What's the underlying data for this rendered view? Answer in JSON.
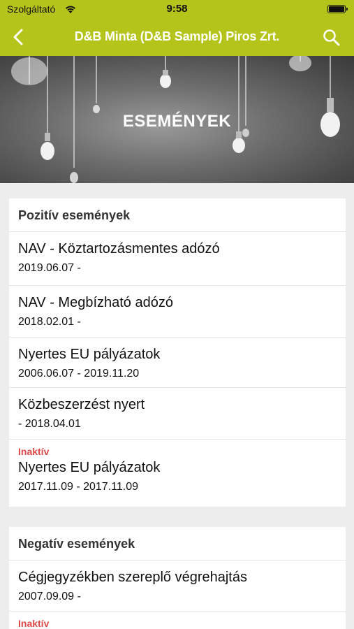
{
  "status_bar": {
    "carrier": "Szolgáltató",
    "time": "9:58"
  },
  "nav": {
    "title": "D&B Minta (D&B Sample) Piros Zrt.",
    "accent": "#b5c41a"
  },
  "hero": {
    "title": "ESEMÉNYEK"
  },
  "positive": {
    "header": "Pozitív események",
    "items": [
      {
        "name": "NAV - Köztartozásmentes adózó",
        "dates": "2019.06.07 -"
      },
      {
        "name": "NAV - Megbízható adózó",
        "dates": "2018.02.01 -"
      },
      {
        "name": "Nyertes EU pályázatok",
        "dates": "2006.06.07 - 2019.11.20"
      },
      {
        "name": "Közbeszerzést nyert",
        "dates": "- 2018.04.01"
      },
      {
        "tag": "Inaktív",
        "name": "Nyertes EU pályázatok",
        "dates": "2017.11.09 - 2017.11.09"
      }
    ]
  },
  "negative": {
    "header": "Negatív események",
    "items": [
      {
        "name": "Cégjegyzékben szereplő végrehajtás",
        "dates": "2007.09.09 -"
      },
      {
        "tag": "Inaktív"
      }
    ]
  },
  "colors": {
    "inactive": "#e0484a"
  }
}
